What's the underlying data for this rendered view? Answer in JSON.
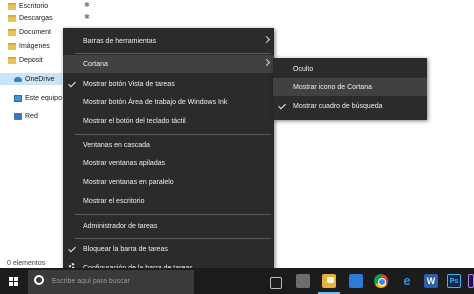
{
  "nav": {
    "items": [
      {
        "label": "Escritorio",
        "pinned": true
      },
      {
        "label": "Descargas",
        "pinned": true
      },
      {
        "label": "Document",
        "pinned": false
      },
      {
        "label": "Imágenes",
        "pinned": false
      },
      {
        "label": "Deposit",
        "pinned": false
      },
      {
        "label": "OneDrive",
        "pinned": false
      },
      {
        "label": "Este equipo",
        "pinned": false
      },
      {
        "label": "Red",
        "pinned": false
      }
    ],
    "pin_glyph": "📌",
    "pin_glyph_alt": "✱"
  },
  "status_bar": {
    "items_count": "0 elementos"
  },
  "context_menu": {
    "toolbars": "Barras de herramientas",
    "cortana": "Cortana",
    "show_task_view": "Mostrar botón Vista de tareas",
    "show_ink_workspace": "Mostrar botón Área de trabajo de Windows Ink",
    "show_touch_keyboard": "Mostrar el botón del teclado táctil",
    "cascade": "Ventanas en cascada",
    "stacked": "Mostrar ventanas apiladas",
    "side_by_side": "Mostrar ventanas en paralelo",
    "show_desktop": "Mostrar el escritorio",
    "task_manager": "Administrador de tareas",
    "lock_taskbar": "Bloquear la barra de tareas",
    "taskbar_settings": "Configuración de la barra de tareas"
  },
  "cortana_submenu": {
    "hidden": "Oculto",
    "show_icon": "Mostrar icono de Cortana",
    "show_search_box": "Mostrar cuadro de búsqueda"
  },
  "taskbar": {
    "search_placeholder": "Escribe aquí para buscar",
    "apps": [
      "task-view",
      "calculator",
      "file-explorer",
      "store",
      "chrome",
      "edge",
      "word",
      "photoshop",
      "premiere"
    ]
  },
  "colors": {
    "menu_bg": "#2b2b2b",
    "menu_highlight": "#414141",
    "taskbar_bg": "#1c1c1c",
    "selection": "#cce4f7",
    "accent": "#76b9ed"
  }
}
